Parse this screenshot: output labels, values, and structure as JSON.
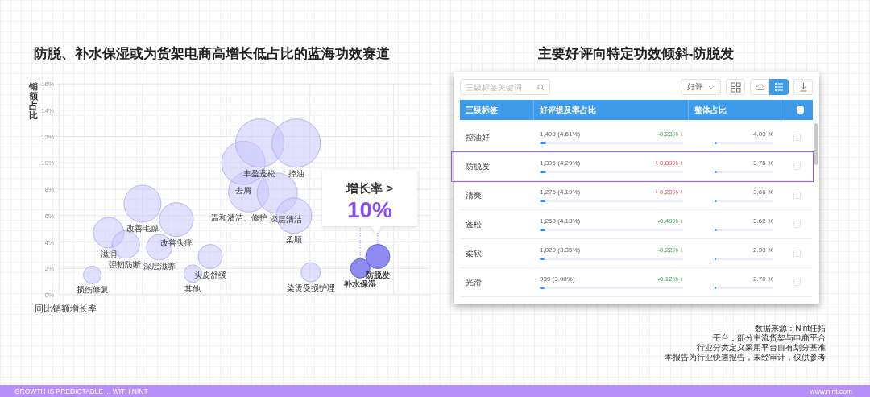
{
  "left_panel": {
    "title": "防脱、补水保湿或为货架电商高增长低占比的蓝海功效赛道",
    "bubble_chart": {
      "y_axis_title": "销额占比",
      "x_axis_title": "同比销额增长率",
      "y_ticks": [
        "16%",
        "14%",
        "12%",
        "10%",
        "8%",
        "6%",
        "4%",
        "2%",
        "0%"
      ],
      "bubbles": [
        {
          "label": "损伤修复",
          "highlight": false
        },
        {
          "label": "滋润",
          "highlight": false
        },
        {
          "label": "强韧防断",
          "highlight": false
        },
        {
          "label": "改善毛躁",
          "highlight": false
        },
        {
          "label": "深层滋养",
          "highlight": false
        },
        {
          "label": "改善头痒",
          "highlight": false
        },
        {
          "label": "其他",
          "highlight": false
        },
        {
          "label": "头皮舒缓",
          "highlight": false
        },
        {
          "label": "温和清洁、修护",
          "highlight": false
        },
        {
          "label": "去屑",
          "highlight": false
        },
        {
          "label": "丰盈蓬松",
          "highlight": false
        },
        {
          "label": "控油",
          "highlight": false
        },
        {
          "label": "深层清洁",
          "highlight": false
        },
        {
          "label": "柔顺",
          "highlight": false
        },
        {
          "label": "染烫受损护理",
          "highlight": false
        },
        {
          "label": "补水保湿",
          "highlight": true
        },
        {
          "label": "防脱发",
          "highlight": true
        }
      ],
      "callout": {
        "label": "增长率 >",
        "value": "10%"
      }
    }
  },
  "right_panel": {
    "title": "主要好评向特定功效倾斜-防脱发",
    "toolbar": {
      "search": {
        "placeholder": "三级标签关键词"
      },
      "filter": {
        "value": "好评"
      },
      "view_buttons": [
        {
          "kind": "grid",
          "selected": false
        },
        {
          "kind": "cloud",
          "selected": false
        },
        {
          "kind": "list",
          "selected": true
        },
        {
          "kind": "download",
          "selected": false
        }
      ]
    },
    "table": {
      "columns": [
        "三级标签",
        "好评提及率占比",
        "整体占比"
      ],
      "header_checked": false,
      "rows": [
        {
          "label": "控油好",
          "mentions": "1,403 (4.61%)",
          "mention_bar": {
            "level": 0.046
          },
          "change": {
            "text": "-0.23% ↓",
            "kind": "down"
          },
          "overall": "4.03 %",
          "overall_bar": {
            "level": 0.04
          },
          "checked": false,
          "selected": false
        },
        {
          "label": "防脱发",
          "mentions": "1,306 (4.29%)",
          "mention_bar": {
            "level": 0.043
          },
          "change": {
            "text": "+ 0.89% ↑",
            "kind": "up"
          },
          "overall": "3.75 %",
          "overall_bar": {
            "level": 0.038
          },
          "checked": false,
          "selected": true
        },
        {
          "label": "清爽",
          "mentions": "1,275 (4.19%)",
          "mention_bar": {
            "level": 0.042
          },
          "change": {
            "text": "+ 0.20% ↑",
            "kind": "up"
          },
          "overall": "3.66 %",
          "overall_bar": {
            "level": 0.037
          },
          "checked": false,
          "selected": false
        },
        {
          "label": "蓬松",
          "mentions": "1,258 (4.13%)",
          "mention_bar": {
            "level": 0.041
          },
          "change": {
            "text": "-0.49% ↓",
            "kind": "down"
          },
          "overall": "3.62 %",
          "overall_bar": {
            "level": 0.036
          },
          "checked": false,
          "selected": false
        },
        {
          "label": "柔软",
          "mentions": "1,020 (3.35%)",
          "mention_bar": {
            "level": 0.034
          },
          "change": {
            "text": "-0.22% ↓",
            "kind": "down"
          },
          "overall": "2.93 %",
          "overall_bar": {
            "level": 0.029
          },
          "checked": false,
          "selected": false
        },
        {
          "label": "光滑",
          "mentions": "939 (3.08%)",
          "mention_bar": {
            "level": 0.031
          },
          "change": {
            "text": "-0.12% ↓",
            "kind": "down"
          },
          "overall": "2.70 %",
          "overall_bar": {
            "level": 0.027
          },
          "checked": false,
          "selected": false
        }
      ]
    }
  },
  "notes": [
    "数据来源：Nint任拓",
    "平台：部分主流货架与电商平台",
    "行业分类定义采用平台自有划分基准",
    "本报告为行业快速报告，未经审计，仅供参考"
  ],
  "footer": {
    "slogan": "GROWTH IS PREDICTABLE ... WITH NINT",
    "url": "www.nint.com"
  }
}
